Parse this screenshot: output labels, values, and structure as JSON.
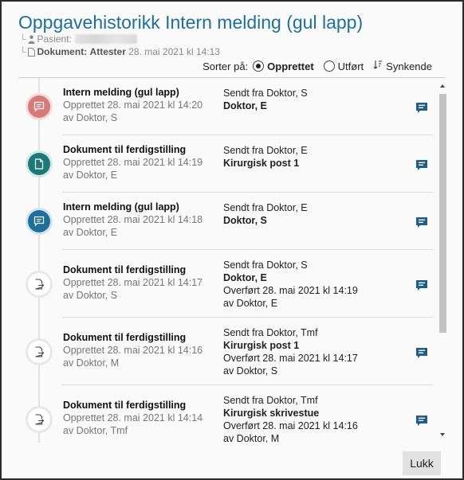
{
  "dialog": {
    "title": "Oppgavehistorikk Intern melding (gul lapp)",
    "patient_label": "Pasient:",
    "document_label": "Dokument:",
    "document_type": "Attester",
    "document_date": "28. mai 2021 kl 14:13"
  },
  "sort": {
    "label": "Sorter på:",
    "options": [
      {
        "label": "Opprettet",
        "selected": true
      },
      {
        "label": "Utført",
        "selected": false
      }
    ],
    "direction_label": "Synkende"
  },
  "colors": {
    "title": "#1d6f9c",
    "badge_message_red": "#d97a7a",
    "badge_teal": "#1b7a78",
    "badge_blue": "#1d6f9c",
    "note_icon": "#1d5f8a"
  },
  "tasks": [
    {
      "icon": "message-icon",
      "badge": "red",
      "title": "Intern melding (gul lapp)",
      "created": "Opprettet 28. mai 2021 kl 14:20",
      "created_by": "av Doktor, S",
      "sent_from": "Sendt fra Doktor, S",
      "recipient": "Doktor, E",
      "transferred": "",
      "transferred_by": ""
    },
    {
      "icon": "document-icon",
      "badge": "teal",
      "title": "Dokument til ferdigstilling",
      "created": "Opprettet 28. mai 2021 kl 14:19",
      "created_by": "av Doktor, E",
      "sent_from": "Sendt fra Doktor, E",
      "recipient": "Kirurgisk post 1",
      "transferred": "",
      "transferred_by": ""
    },
    {
      "icon": "message-icon",
      "badge": "blue",
      "title": "Intern melding (gul lapp)",
      "created": "Opprettet 28. mai 2021 kl 14:18",
      "created_by": "av Doktor, E",
      "sent_from": "Sendt fra Doktor, E",
      "recipient": "Doktor, S",
      "transferred": "",
      "transferred_by": ""
    },
    {
      "icon": "document-forward-icon",
      "badge": "grey",
      "title": "Dokument til ferdigstilling",
      "created": "Opprettet 28. mai 2021 kl 14:17",
      "created_by": "av Doktor, S",
      "sent_from": "Sendt fra Doktor, S",
      "recipient": "Doktor, E",
      "transferred": "Overført 28. mai 2021 kl 14:19",
      "transferred_by": "av Doktor, E"
    },
    {
      "icon": "document-forward-icon",
      "badge": "grey",
      "title": "Dokument til ferdigstilling",
      "created": "Opprettet 28. mai 2021 kl 14:16",
      "created_by": "av Doktor, M",
      "sent_from": "Sendt fra Doktor, Tmf",
      "recipient": "Kirurgisk post 1",
      "transferred": "Overført 28. mai 2021 kl 14:17",
      "transferred_by": "av Doktor, S"
    },
    {
      "icon": "document-forward-icon",
      "badge": "grey",
      "title": "Dokument til ferdigstilling",
      "created": "Opprettet 28. mai 2021 kl 14:14",
      "created_by": "av Doktor, Tmf",
      "sent_from": "Sendt fra Doktor, Tmf",
      "recipient": "Kirurgisk skrivestue",
      "transferred": "Overført 28. mai 2021 kl 14:16",
      "transferred_by": "av Doktor, M"
    }
  ],
  "footer": {
    "close_label": "Lukk"
  }
}
